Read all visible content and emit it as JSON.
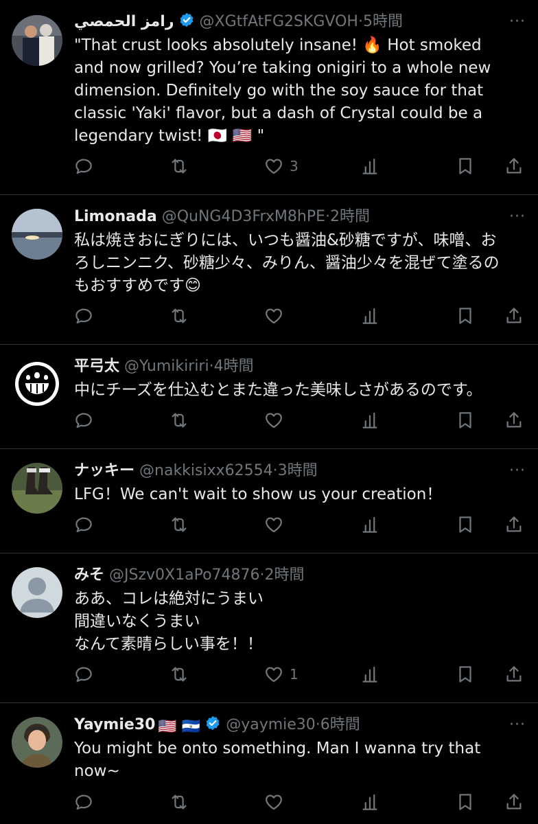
{
  "tweets": [
    {
      "name": "رامز الحمصي",
      "verified": true,
      "handle": "@XGtfAtFG2SKGVOH",
      "time": "5時間",
      "body": "\"That crust looks absolutely insane! 🔥 Hot smoked and now grilled? You’re taking onigiri to a whole new dimension. Definitely go with the soy sauce for that classic 'Yaki' flavor, but a dash of Crystal could be a legendary twist! 🇯🇵 🇺🇸 \"",
      "likes": "3",
      "avatar": "photo-two-men"
    },
    {
      "name": "Limonada",
      "verified": false,
      "handle": "@QuNG4D3FrxM8hPE",
      "time": "2時間",
      "body": "私は焼きおにぎりには、いつも醤油&砂糖ですが、味噌、おろしニンニク、砂糖少々、みりん、醤油少々を混ぜて塗るのもおすすめです😊",
      "likes": "",
      "avatar": "photo-sunset-lake"
    },
    {
      "name": "平弓太",
      "verified": false,
      "handle": "@Yumikiriri",
      "time": "4時間",
      "body": "中にチーズを仕込むとまた違った美味しさがあるのです。",
      "likes": "",
      "avatar": "paulownia-crest"
    },
    {
      "name": "ナッキー",
      "verified": false,
      "handle": "@nakkisixx62554",
      "time": "3時間",
      "body": "LFG！We can't wait to show us your creation！",
      "likes": "",
      "avatar": "photo-boots"
    },
    {
      "name": "みそ",
      "verified": false,
      "handle": "@JSzv0X1aPo74876",
      "time": "2時間",
      "body": "ああ、コレは絶対にうまい\n間違いなくうまい\nなんて素晴らしい事を！！",
      "likes": "1",
      "avatar": "default-person"
    },
    {
      "name": "Yaymie30",
      "verified": true,
      "name_flags": "🇺🇸 🇸🇻",
      "handle": "@yaymie30",
      "time": "6時間",
      "body": "You might be onto something. Man I wanna try that now~",
      "likes": "",
      "avatar": "anime-character"
    }
  ],
  "dot_separator": "·",
  "more_glyph": "···",
  "colors": {
    "background": "#000000",
    "text": "#e7e9ea",
    "muted": "#71767b",
    "verified": "#1d9bf0",
    "divider": "#2f3336"
  },
  "icons": [
    "reply-icon",
    "retweet-icon",
    "like-icon",
    "views-icon",
    "bookmark-icon",
    "share-icon",
    "more-icon",
    "verified-badge-icon"
  ]
}
